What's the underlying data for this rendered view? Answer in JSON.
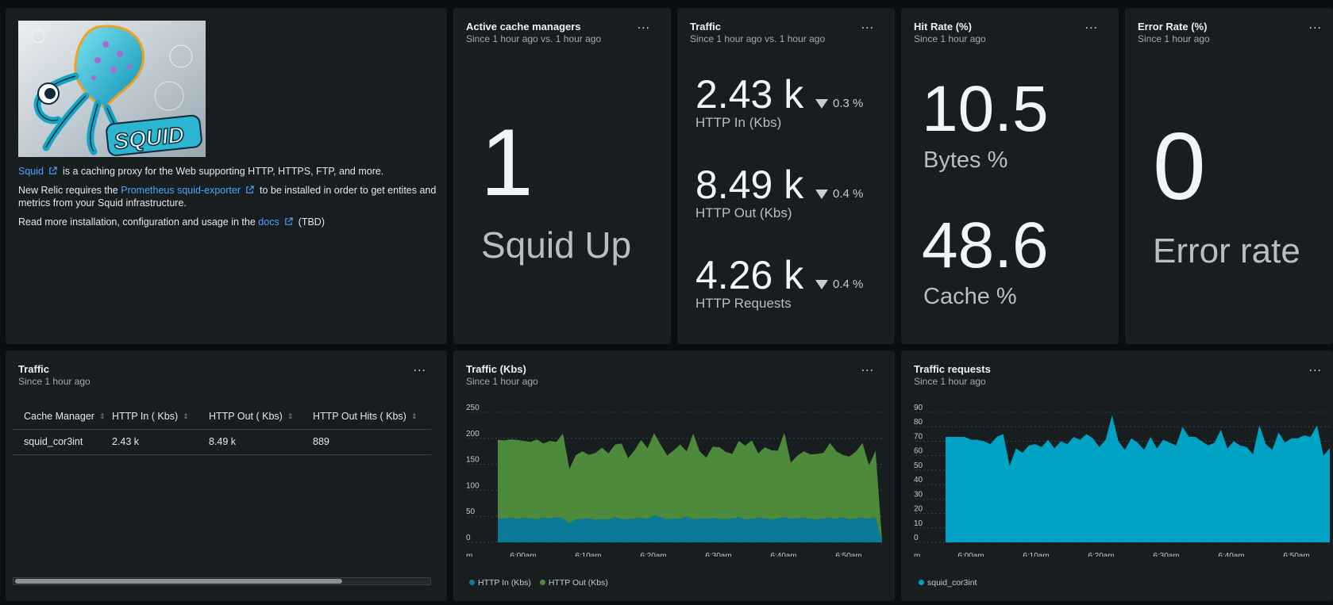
{
  "info": {
    "image_alt": "Squid logo",
    "logo_text": "SQUID",
    "squid_link": "Squid",
    "line1_rest": "is a caching proxy for the Web supporting HTTP, HTTPS, FTP, and more.",
    "line2_pre": "New Relic requires the",
    "exporter_link": "Prometheus squid-exporter",
    "line2_post": "to be installed in order to get entites and metrics from your Squid infrastructure.",
    "line3_pre": "Read more installation, configuration and usage in the",
    "docs_link": "docs",
    "line3_post": "(TBD)"
  },
  "active": {
    "title": "Active cache managers",
    "subtitle": "Since 1 hour ago vs. 1 hour ago",
    "value": "1",
    "label": "Squid Up"
  },
  "traffic_kpi": {
    "title": "Traffic",
    "subtitle": "Since 1 hour ago vs. 1 hour ago",
    "metrics": [
      {
        "value": "2.43 k",
        "label": "HTTP In (Kbs)",
        "delta": "0.3 %"
      },
      {
        "value": "8.49 k",
        "label": "HTTP Out (Kbs)",
        "delta": "0.4 %"
      },
      {
        "value": "4.26 k",
        "label": "HTTP Requests",
        "delta": "0.4 %"
      }
    ]
  },
  "hit_rate": {
    "title": "Hit Rate (%)",
    "subtitle": "Since 1 hour ago",
    "metrics": [
      {
        "value": "10.5",
        "label": "Bytes %"
      },
      {
        "value": "48.6",
        "label": "Cache %"
      }
    ]
  },
  "error_rate": {
    "title": "Error Rate (%)",
    "subtitle": "Since 1 hour ago",
    "value": "0",
    "label": "Error rate"
  },
  "traffic_table": {
    "title": "Traffic",
    "subtitle": "Since 1 hour ago",
    "columns": [
      "Cache Manager",
      "HTTP In ( Kbs)",
      "HTTP Out ( Kbs)",
      "HTTP Out Hits ( Kbs)"
    ],
    "rows": [
      [
        "squid_cor3int",
        "2.43 k",
        "8.49 k",
        "889"
      ]
    ]
  },
  "menu_glyph": "...",
  "colors": {
    "http_in": "#0a7a99",
    "http_out": "#4e8a3c",
    "requests": "#00a3c4",
    "link": "#4da3ff"
  },
  "chart_data": [
    {
      "type": "area",
      "title": "Traffic (Kbs)",
      "subtitle": "Since 1 hour ago",
      "ylim": [
        0,
        250
      ],
      "y_ticks": [
        "0",
        "50",
        "100",
        "150",
        "200",
        "250"
      ],
      "x_ticks": [
        "m",
        "6:00am",
        "6:10am",
        "6:20am",
        "6:30am",
        "6:40am",
        "6:50am"
      ],
      "stacked": true,
      "series": [
        {
          "name": "HTTP In (Kbs)",
          "values": [
            46,
            46,
            47,
            45,
            47,
            46,
            44,
            47,
            46,
            48,
            46,
            37,
            44,
            45,
            46,
            43,
            45,
            44,
            48,
            45,
            44,
            46,
            47,
            45,
            52,
            48,
            44,
            46,
            45,
            50,
            44,
            46,
            45,
            47,
            45,
            44,
            46,
            48,
            44,
            45,
            47,
            46,
            44,
            46,
            48,
            45,
            46,
            47,
            45,
            44,
            46,
            47,
            45,
            48,
            44,
            46,
            47,
            45,
            48,
            1
          ]
        },
        {
          "name": "HTTP Out (Kbs)",
          "values": [
            151,
            150,
            151,
            152,
            148,
            147,
            154,
            143,
            149,
            145,
            163,
            104,
            124,
            130,
            122,
            129,
            137,
            127,
            140,
            145,
            118,
            131,
            150,
            136,
            158,
            140,
            123,
            131,
            143,
            125,
            165,
            129,
            118,
            137,
            138,
            130,
            124,
            147,
            142,
            151,
            124,
            137,
            133,
            130,
            163,
            108,
            121,
            128,
            124,
            126,
            126,
            144,
            130,
            120,
            121,
            129,
            144,
            103,
            128,
            2
          ]
        }
      ],
      "legend": [
        "HTTP In (Kbs)",
        "HTTP Out (Kbs)"
      ],
      "legend_position": "bottom-left",
      "grid": true
    },
    {
      "type": "area",
      "title": "Traffic requests",
      "subtitle": "Since 1 hour ago",
      "ylim": [
        0,
        90
      ],
      "y_ticks": [
        "0",
        "10",
        "20",
        "30",
        "40",
        "50",
        "60",
        "70",
        "80",
        "90"
      ],
      "x_ticks": [
        "m",
        "6:00am",
        "6:10am",
        "6:20am",
        "6:30am",
        "6:40am",
        "6:50am"
      ],
      "series": [
        {
          "name": "squid_cor3int",
          "values": [
            73,
            73,
            73,
            73,
            71,
            71,
            70,
            68,
            73,
            75,
            53,
            65,
            62,
            67,
            68,
            66,
            71,
            65,
            70,
            68,
            73,
            71,
            75,
            72,
            66,
            71,
            88,
            70,
            64,
            72,
            69,
            64,
            73,
            65,
            71,
            69,
            67,
            80,
            73,
            73,
            70,
            67,
            69,
            78,
            65,
            70,
            67,
            66,
            61,
            81,
            68,
            64,
            76,
            69,
            72,
            72,
            74,
            73,
            81,
            60,
            65
          ]
        }
      ],
      "legend": [
        "squid_cor3int"
      ],
      "legend_position": "bottom-left",
      "grid": true
    }
  ]
}
